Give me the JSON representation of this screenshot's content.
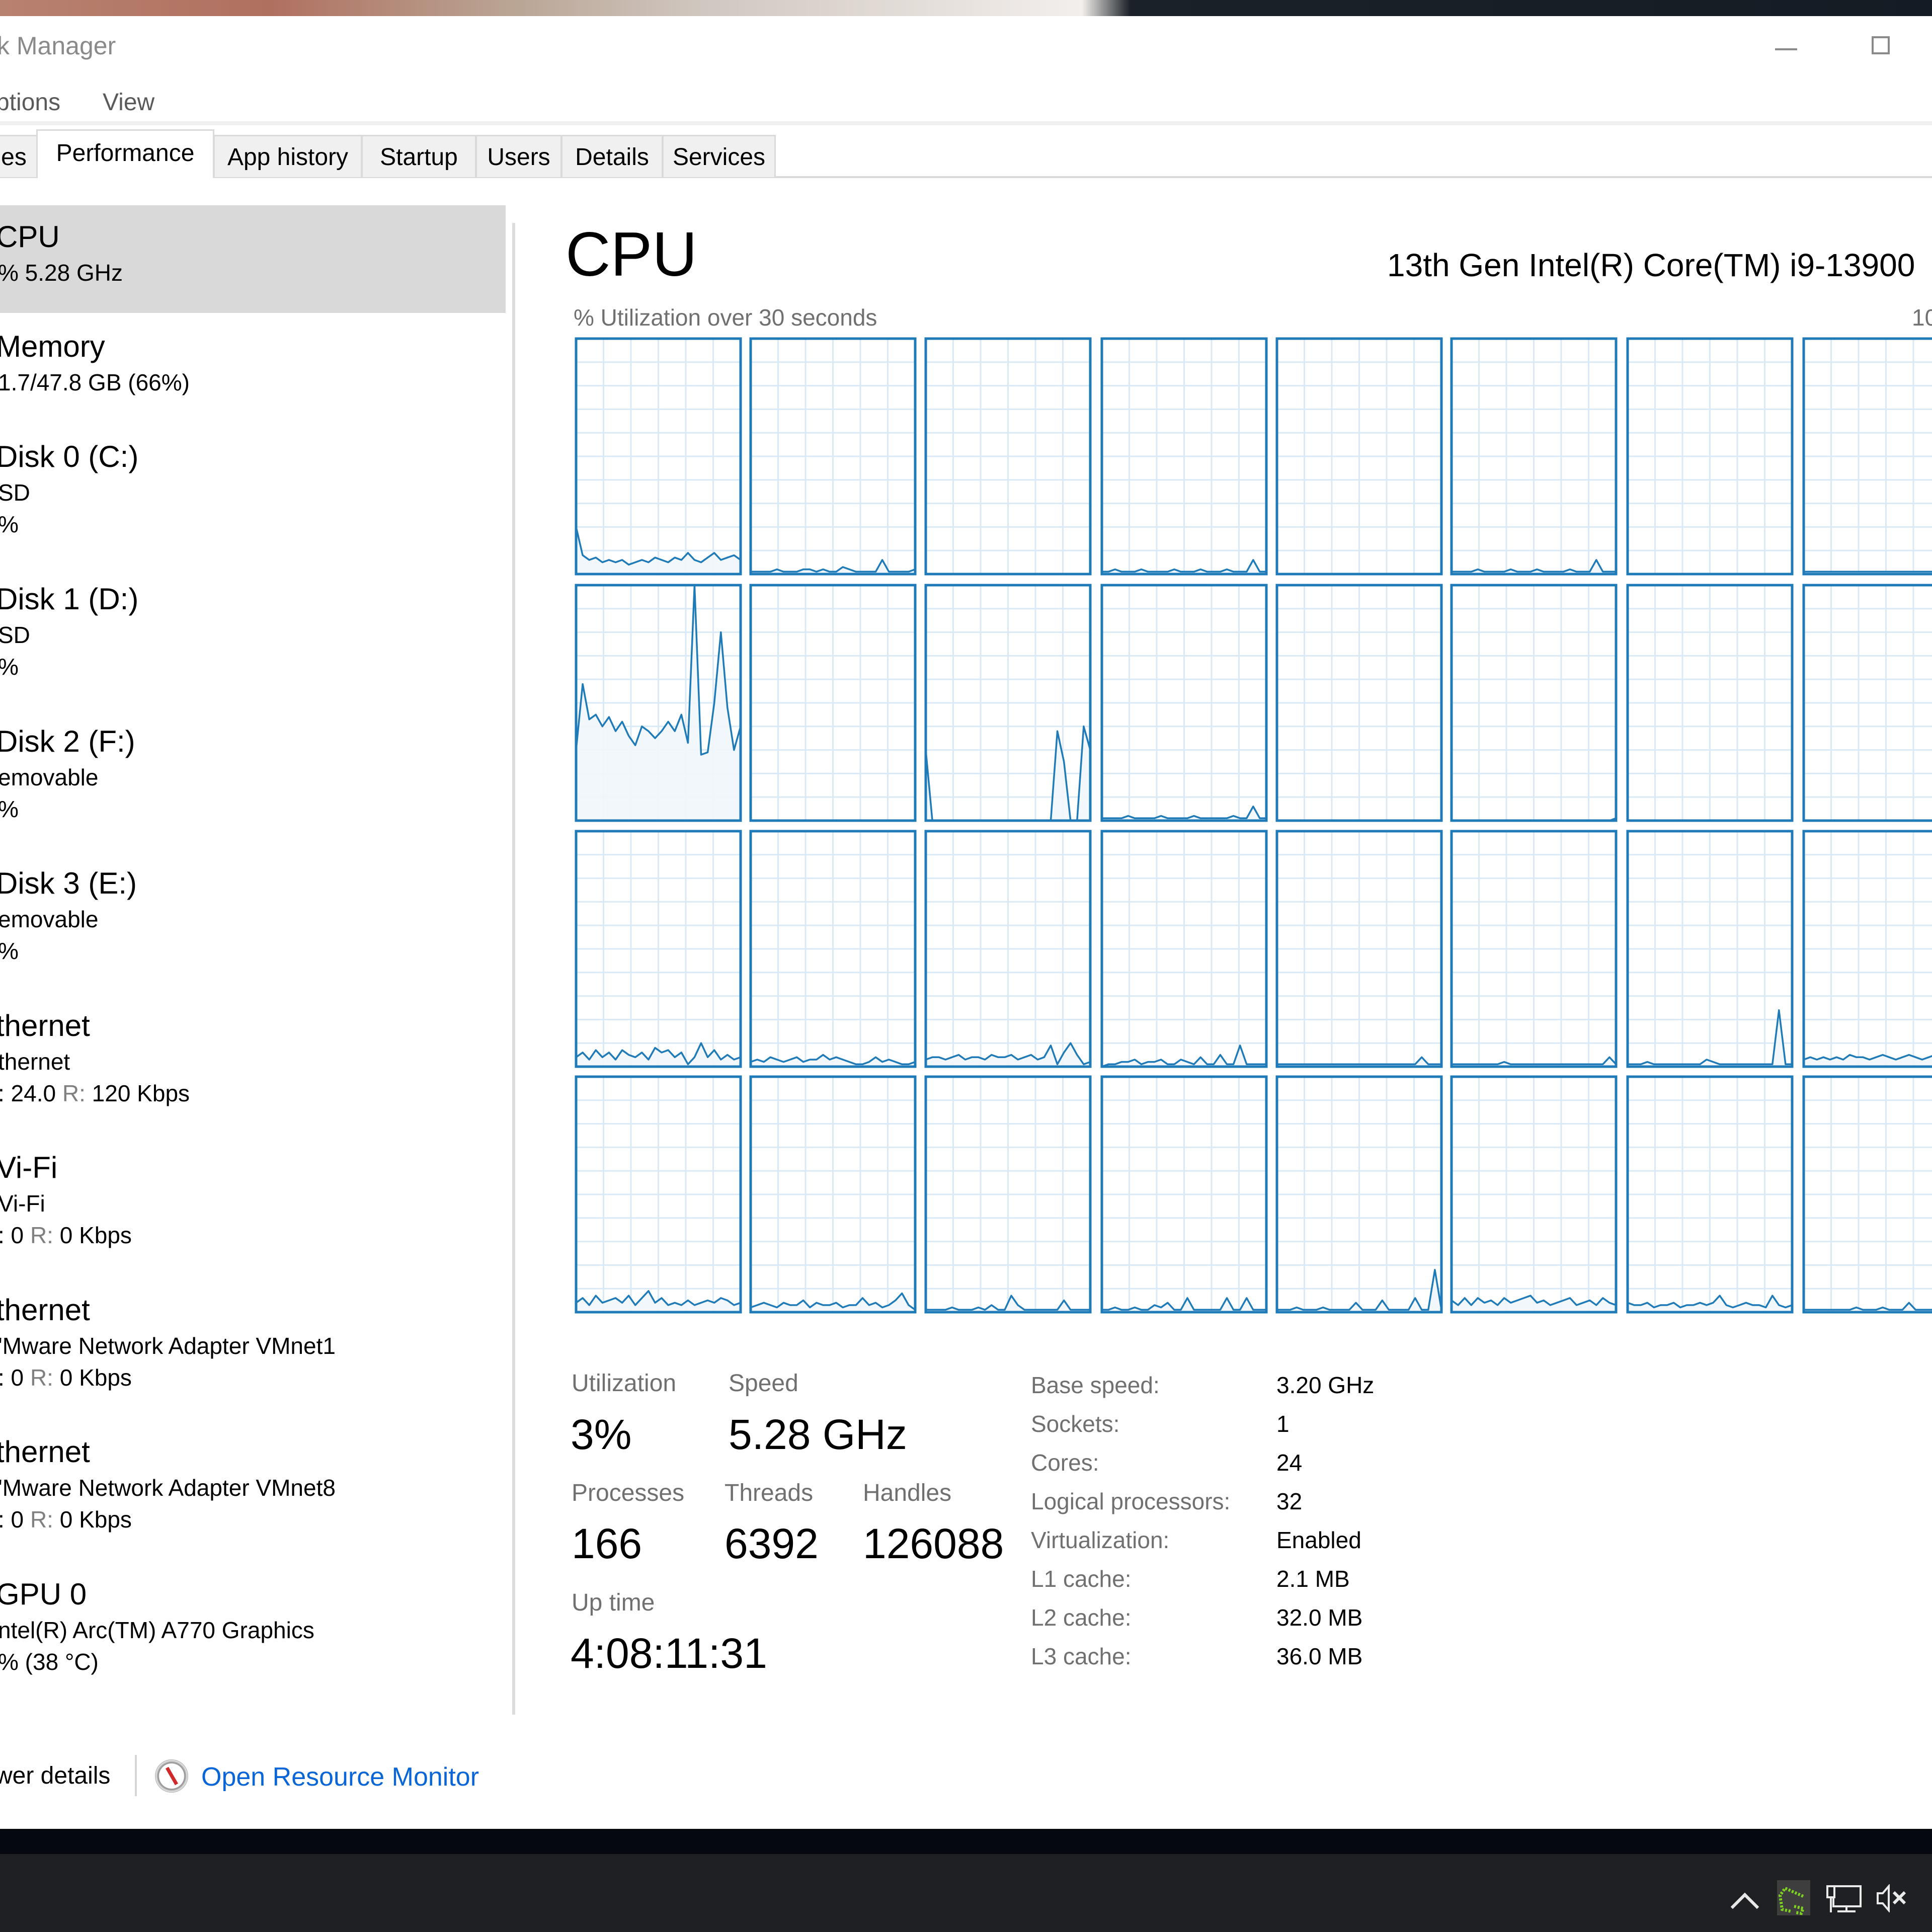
{
  "window": {
    "title": "k Manager",
    "controls": {
      "minimize": "minimize",
      "maximize": "maximize"
    }
  },
  "menu": {
    "items": [
      "ptions",
      "View"
    ]
  },
  "tabs": [
    {
      "label": "es",
      "active": false
    },
    {
      "label": "Performance",
      "active": true
    },
    {
      "label": "App history",
      "active": false
    },
    {
      "label": "Startup",
      "active": false
    },
    {
      "label": "Users",
      "active": false
    },
    {
      "label": "Details",
      "active": false
    },
    {
      "label": "Services",
      "active": false
    }
  ],
  "sidebar": {
    "items": [
      {
        "title": "CPU",
        "sub": "%  5.28 GHz",
        "selected": true
      },
      {
        "title": "Memory",
        "sub": "1.7/47.8 GB (66%)"
      },
      {
        "title": "Disk 0 (C:)",
        "sub": "SD",
        "sub2": "%"
      },
      {
        "title": "Disk 1 (D:)",
        "sub": "SD",
        "sub2": "%"
      },
      {
        "title": "Disk 2 (F:)",
        "sub": "emovable",
        "sub2": "%"
      },
      {
        "title": "Disk 3 (E:)",
        "sub": "emovable",
        "sub2": "%"
      },
      {
        "title": "thernet",
        "sub": "thernet",
        "s_prefix": ": 24.0 ",
        "r_label": "R:",
        "r_value": " 120 Kbps"
      },
      {
        "title": "Vi-Fi",
        "sub": "Vi-Fi",
        "s_prefix": ": 0 ",
        "r_label": "R:",
        "r_value": " 0 Kbps"
      },
      {
        "title": "thernet",
        "sub": "'Mware Network Adapter VMnet1",
        "s_prefix": ": 0 ",
        "r_label": "R:",
        "r_value": " 0 Kbps"
      },
      {
        "title": "thernet",
        "sub": "'Mware Network Adapter VMnet8",
        "s_prefix": ": 0 ",
        "r_label": "R:",
        "r_value": " 0 Kbps"
      },
      {
        "title": "GPU 0",
        "sub": "ntel(R) Arc(TM) A770 Graphics",
        "sub2": "%  (38 °C)"
      }
    ]
  },
  "main": {
    "title": "CPU",
    "model": "13th Gen Intel(R) Core(TM) i9-13900",
    "graph_caption": "% Utilization over 30 seconds",
    "graph_max_label": "10",
    "stats": {
      "utilization": {
        "label": "Utilization",
        "value": "3%"
      },
      "speed": {
        "label": "Speed",
        "value": "5.28 GHz"
      },
      "processes": {
        "label": "Processes",
        "value": "166"
      },
      "threads": {
        "label": "Threads",
        "value": "6392"
      },
      "handles": {
        "label": "Handles",
        "value": "126088"
      },
      "uptime": {
        "label": "Up time",
        "value": "4:08:11:31"
      }
    },
    "specs": [
      {
        "label": "Base speed:",
        "value": "3.20 GHz"
      },
      {
        "label": "Sockets:",
        "value": "1"
      },
      {
        "label": "Cores:",
        "value": "24"
      },
      {
        "label": "Logical processors:",
        "value": "32"
      },
      {
        "label": "Virtualization:",
        "value": "Enabled"
      },
      {
        "label": "L1 cache:",
        "value": "2.1 MB"
      },
      {
        "label": "L2 cache:",
        "value": "32.0 MB"
      },
      {
        "label": "L3 cache:",
        "value": "36.0 MB"
      }
    ]
  },
  "footer": {
    "fewer_details": "wer details",
    "open_resource_monitor": "Open Resource Monitor"
  },
  "colors": {
    "graph_line": "#1f7ab8",
    "graph_grid": "#d9eaf6",
    "graph_fill": "#f1f6fb",
    "link": "#0a66d6",
    "tray_app": "#7ed321"
  },
  "chart_data": {
    "type": "line",
    "title": "% Utilization over 30 seconds",
    "xlabel": "",
    "ylabel": "% Utilization",
    "ylim": [
      0,
      100
    ],
    "x_range_seconds": [
      0,
      30
    ],
    "grid": true,
    "grid_divisions": {
      "x": 6,
      "y": 10
    },
    "layout": "4 rows × 8 visible columns of per-logical-processor graphs",
    "series": [
      {
        "name": "LP0",
        "values": [
          20,
          8,
          6,
          7,
          5,
          6,
          5,
          6,
          4,
          5,
          6,
          5,
          7,
          6,
          5,
          7,
          6,
          9,
          6,
          5,
          7,
          9,
          6,
          7,
          8,
          6
        ]
      },
      {
        "name": "LP1",
        "values": [
          1,
          1,
          1,
          1,
          2,
          1,
          1,
          1,
          2,
          2,
          1,
          2,
          1,
          1,
          3,
          2,
          1,
          1,
          1,
          1,
          6,
          1,
          1,
          1,
          1,
          2
        ]
      },
      {
        "name": "LP2",
        "values": [
          0,
          0,
          0,
          0,
          0,
          0,
          0,
          0,
          0,
          0,
          0,
          0,
          0,
          0,
          0,
          0,
          0,
          0,
          0,
          0,
          0,
          0,
          0,
          0,
          0,
          0
        ]
      },
      {
        "name": "LP3",
        "values": [
          1,
          1,
          2,
          1,
          1,
          1,
          2,
          1,
          1,
          1,
          1,
          2,
          1,
          1,
          1,
          2,
          1,
          1,
          1,
          2,
          1,
          1,
          1,
          6,
          1,
          1
        ]
      },
      {
        "name": "LP4",
        "values": [
          0,
          0,
          0,
          0,
          0,
          0,
          0,
          0,
          0,
          0,
          0,
          0,
          0,
          0,
          0,
          0,
          0,
          0,
          0,
          0,
          0,
          0,
          0,
          0,
          0,
          0
        ]
      },
      {
        "name": "LP5",
        "values": [
          1,
          1,
          1,
          1,
          2,
          1,
          1,
          1,
          1,
          2,
          1,
          1,
          1,
          2,
          1,
          1,
          1,
          1,
          2,
          1,
          1,
          1,
          6,
          1,
          1,
          1
        ]
      },
      {
        "name": "LP6",
        "values": [
          0,
          0,
          0,
          0,
          0,
          0,
          0,
          0,
          0,
          0,
          0,
          0,
          0,
          0,
          0,
          0,
          0,
          0,
          0,
          0,
          0,
          0,
          0,
          0,
          0,
          0
        ]
      },
      {
        "name": "LP7",
        "values": [
          1,
          1,
          1,
          1,
          1,
          1,
          1,
          1,
          1,
          1,
          1,
          1,
          1,
          1,
          1,
          1,
          1,
          1,
          1,
          1,
          1,
          1,
          1,
          1,
          1,
          1
        ]
      },
      {
        "name": "LP8",
        "values": [
          30,
          58,
          43,
          45,
          40,
          44,
          38,
          42,
          36,
          32,
          40,
          38,
          35,
          38,
          42,
          38,
          45,
          33,
          100,
          28,
          29,
          50,
          80,
          48,
          30,
          40
        ]
      },
      {
        "name": "LP9",
        "values": [
          0,
          0,
          0,
          0,
          0,
          0,
          0,
          0,
          0,
          0,
          0,
          0,
          0,
          0,
          0,
          0,
          0,
          0,
          0,
          0,
          0,
          0,
          0,
          0,
          0,
          0
        ]
      },
      {
        "name": "LP10",
        "values": [
          30,
          0,
          0,
          0,
          0,
          0,
          0,
          0,
          0,
          0,
          0,
          0,
          0,
          0,
          0,
          0,
          0,
          0,
          0,
          0,
          38,
          25,
          0,
          0,
          40,
          30
        ]
      },
      {
        "name": "LP11",
        "values": [
          1,
          1,
          1,
          1,
          2,
          1,
          1,
          1,
          1,
          2,
          1,
          1,
          1,
          1,
          2,
          1,
          1,
          1,
          1,
          1,
          2,
          1,
          1,
          6,
          1,
          1
        ]
      },
      {
        "name": "LP12",
        "values": [
          0,
          0,
          0,
          0,
          0,
          0,
          0,
          0,
          0,
          0,
          0,
          0,
          0,
          0,
          0,
          0,
          0,
          0,
          0,
          0,
          0,
          0,
          0,
          0,
          0,
          0
        ]
      },
      {
        "name": "LP13",
        "values": [
          0,
          0,
          0,
          0,
          0,
          0,
          0,
          0,
          0,
          0,
          0,
          0,
          0,
          0,
          0,
          0,
          0,
          0,
          0,
          0,
          0,
          0,
          0,
          0,
          0,
          1
        ]
      },
      {
        "name": "LP14",
        "values": [
          0,
          0,
          0,
          0,
          0,
          0,
          0,
          0,
          0,
          0,
          0,
          0,
          0,
          0,
          0,
          0,
          0,
          0,
          0,
          0,
          0,
          0,
          0,
          0,
          0,
          0
        ]
      },
      {
        "name": "LP15",
        "values": [
          0,
          0,
          0,
          0,
          0,
          0,
          0,
          0,
          0,
          0,
          0,
          0,
          0,
          0,
          0,
          0,
          0,
          0,
          0,
          0,
          0,
          0,
          0,
          0,
          0,
          0
        ]
      },
      {
        "name": "LP16",
        "values": [
          4,
          6,
          3,
          7,
          4,
          6,
          3,
          7,
          5,
          4,
          6,
          3,
          8,
          6,
          7,
          4,
          6,
          1,
          4,
          10,
          4,
          7,
          3,
          5,
          3,
          4
        ]
      },
      {
        "name": "LP17",
        "values": [
          2,
          3,
          2,
          4,
          3,
          2,
          3,
          4,
          2,
          3,
          3,
          5,
          3,
          4,
          3,
          2,
          1,
          1,
          2,
          4,
          2,
          3,
          2,
          1,
          1,
          2
        ]
      },
      {
        "name": "LP18",
        "values": [
          3,
          4,
          4,
          3,
          4,
          5,
          3,
          4,
          4,
          3,
          5,
          4,
          4,
          5,
          3,
          4,
          5,
          3,
          4,
          9,
          1,
          6,
          10,
          5,
          1,
          2
        ]
      },
      {
        "name": "LP19",
        "values": [
          0,
          1,
          1,
          2,
          2,
          3,
          1,
          2,
          2,
          3,
          1,
          1,
          3,
          2,
          1,
          4,
          1,
          1,
          5,
          1,
          1,
          9,
          1,
          1,
          1,
          1
        ]
      },
      {
        "name": "LP20",
        "values": [
          1,
          1,
          1,
          1,
          1,
          1,
          1,
          1,
          1,
          1,
          1,
          1,
          1,
          1,
          1,
          1,
          1,
          1,
          1,
          1,
          1,
          1,
          4,
          1,
          1,
          1
        ]
      },
      {
        "name": "LP21",
        "values": [
          1,
          1,
          1,
          1,
          1,
          1,
          1,
          1,
          2,
          1,
          1,
          1,
          1,
          1,
          1,
          1,
          1,
          1,
          1,
          1,
          1,
          1,
          1,
          1,
          4,
          1
        ]
      },
      {
        "name": "LP22",
        "values": [
          1,
          1,
          1,
          2,
          1,
          1,
          1,
          1,
          1,
          1,
          1,
          1,
          3,
          2,
          1,
          1,
          1,
          1,
          1,
          1,
          1,
          1,
          1,
          24,
          1,
          1
        ]
      },
      {
        "name": "LP23",
        "values": [
          3,
          4,
          3,
          4,
          3,
          4,
          3,
          5,
          4,
          4,
          3,
          4,
          5,
          4,
          3,
          4,
          5,
          4,
          3,
          4,
          5,
          6,
          5,
          4,
          3,
          4
        ]
      },
      {
        "name": "LP24",
        "values": [
          4,
          6,
          3,
          7,
          4,
          5,
          6,
          4,
          7,
          3,
          6,
          9,
          4,
          6,
          3,
          4,
          3,
          5,
          3,
          4,
          5,
          4,
          6,
          5,
          3,
          4
        ]
      },
      {
        "name": "LP25",
        "values": [
          2,
          3,
          4,
          3,
          2,
          4,
          3,
          3,
          5,
          2,
          4,
          3,
          3,
          4,
          2,
          3,
          3,
          6,
          3,
          4,
          2,
          3,
          5,
          8,
          3,
          1
        ]
      },
      {
        "name": "LP26",
        "values": [
          1,
          1,
          1,
          1,
          2,
          1,
          1,
          1,
          2,
          1,
          3,
          1,
          1,
          7,
          3,
          1,
          1,
          1,
          1,
          1,
          1,
          5,
          1,
          1,
          1,
          1
        ]
      },
      {
        "name": "LP27",
        "values": [
          1,
          1,
          2,
          1,
          1,
          2,
          1,
          1,
          3,
          2,
          4,
          1,
          1,
          6,
          1,
          1,
          1,
          1,
          1,
          6,
          1,
          1,
          6,
          1,
          1,
          1
        ]
      },
      {
        "name": "LP28",
        "values": [
          1,
          1,
          1,
          2,
          1,
          1,
          1,
          2,
          1,
          1,
          1,
          1,
          4,
          1,
          1,
          1,
          5,
          1,
          1,
          1,
          1,
          6,
          1,
          1,
          18,
          1
        ]
      },
      {
        "name": "LP29",
        "values": [
          5,
          3,
          6,
          3,
          6,
          4,
          5,
          3,
          6,
          4,
          5,
          6,
          7,
          4,
          5,
          3,
          4,
          5,
          6,
          3,
          4,
          5,
          3,
          6,
          4,
          3
        ]
      },
      {
        "name": "LP30",
        "values": [
          4,
          3,
          3,
          4,
          2,
          3,
          3,
          4,
          2,
          3,
          3,
          4,
          3,
          4,
          7,
          3,
          2,
          3,
          4,
          3,
          3,
          2,
          7,
          3,
          2,
          3
        ]
      },
      {
        "name": "LP31",
        "values": [
          1,
          1,
          1,
          1,
          1,
          1,
          1,
          1,
          2,
          1,
          1,
          1,
          2,
          1,
          1,
          1,
          4,
          1,
          1,
          1,
          1,
          3,
          1,
          1,
          1,
          1
        ]
      }
    ]
  }
}
